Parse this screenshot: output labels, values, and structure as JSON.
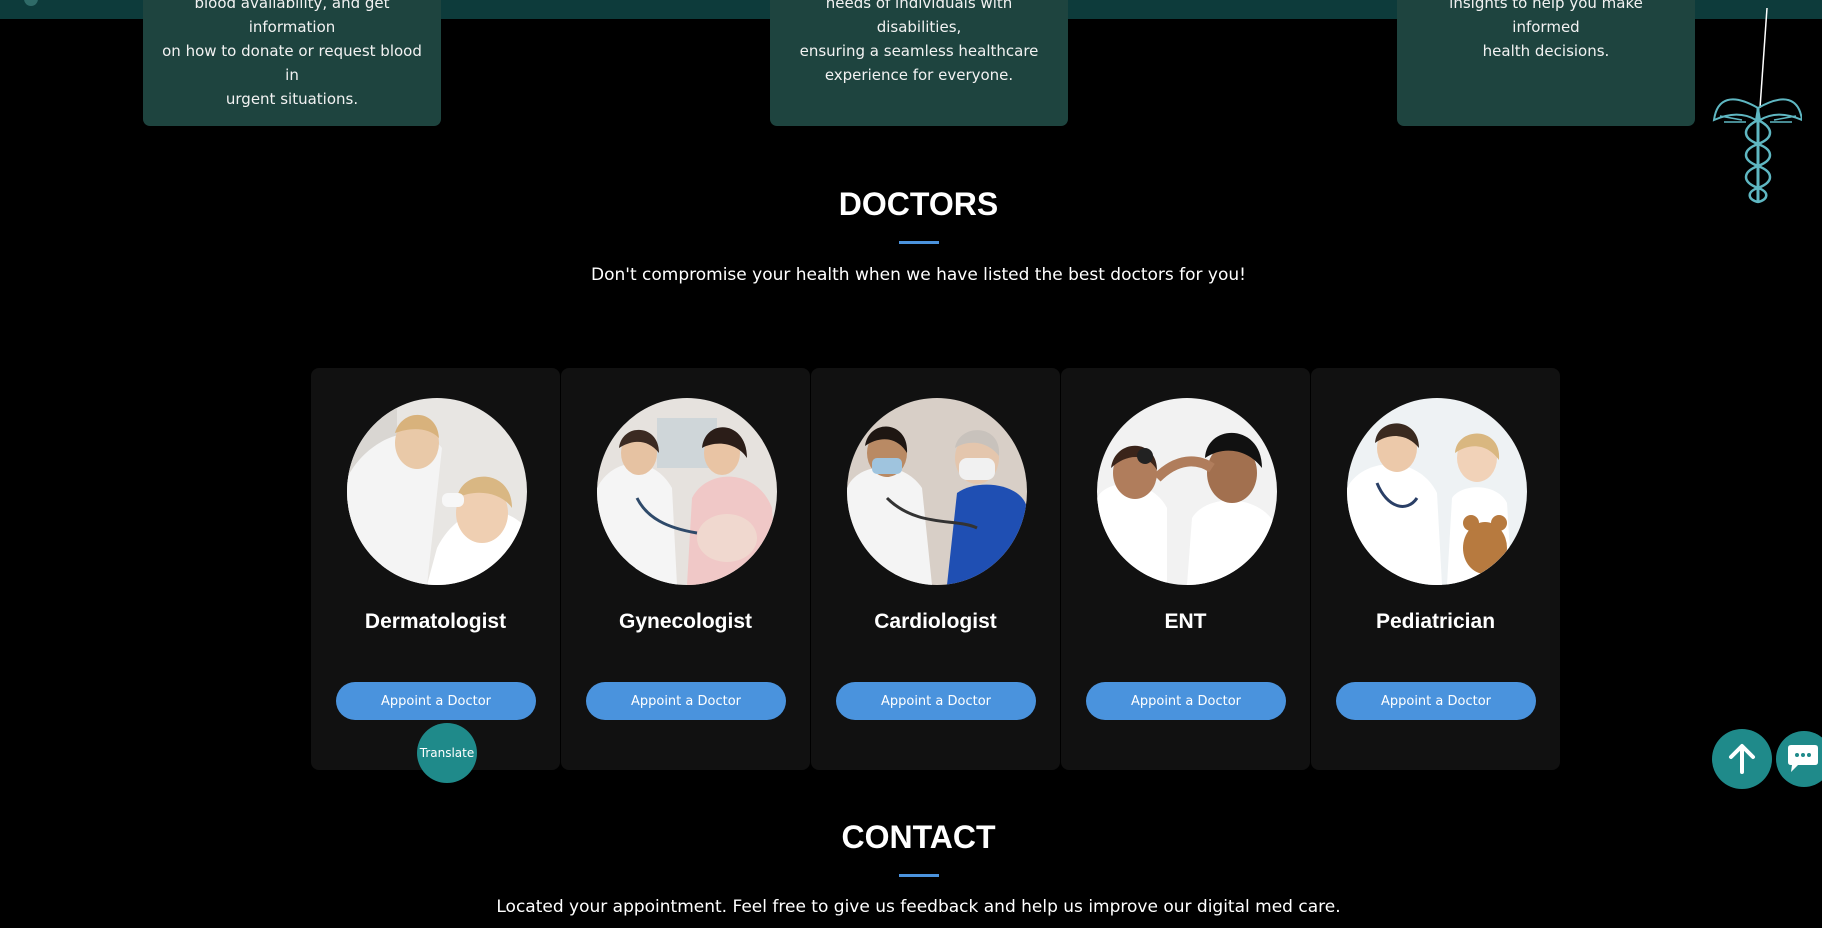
{
  "services": [
    {
      "lines": [
        "blood availability, and get information",
        "on how to donate or request blood in",
        "urgent situations."
      ]
    },
    {
      "lines": [
        "needs of individuals with disabilities,",
        "ensuring a seamless healthcare",
        "experience for everyone."
      ]
    },
    {
      "lines": [
        "insights to help you make informed",
        "health decisions."
      ]
    }
  ],
  "doctors_section": {
    "title": "DOCTORS",
    "subtitle": "Don't compromise your health when we have listed the best doctors for you!",
    "cards": [
      {
        "name": "Dermatologist",
        "button": "Appoint a Doctor"
      },
      {
        "name": "Gynecologist",
        "button": "Appoint a Doctor"
      },
      {
        "name": "Cardiologist",
        "button": "Appoint a Doctor"
      },
      {
        "name": "ENT",
        "button": "Appoint a Doctor"
      },
      {
        "name": "Pediatrician",
        "button": "Appoint a Doctor"
      }
    ]
  },
  "contact_section": {
    "title": "CONTACT",
    "subtitle": "Located your appointment. Feel free to give us feedback and help us improve our digital med care."
  },
  "floating": {
    "translate_label": "Translate",
    "scroll_top_icon": "arrow-up-icon",
    "chat_icon": "chat-icon"
  },
  "colors": {
    "accent": "#4a93dd",
    "teal": "#1f8a8a",
    "card_green": "#1e443f",
    "card_dark": "#111111"
  }
}
